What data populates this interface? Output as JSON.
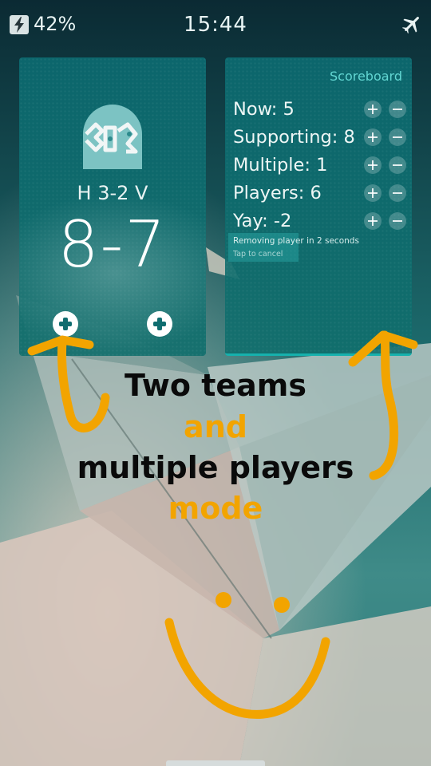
{
  "status": {
    "battery": "42%",
    "time": "15:44",
    "icons": [
      "charging-battery-icon",
      "airplane-mode-icon"
    ]
  },
  "home_cover": {
    "match": "H 3-2 V",
    "score": "8-7",
    "icons": [
      "app-logo-icon",
      "add-home-point-icon",
      "add-visitor-point-icon"
    ]
  },
  "scoreboard_cover": {
    "title": "Scoreboard",
    "rows": [
      {
        "label": "Now: 5"
      },
      {
        "label": "Supporting: 8"
      },
      {
        "label": "Multiple: 1"
      },
      {
        "label": "Players: 6"
      },
      {
        "label": "Yay: -2"
      }
    ],
    "remorse_message": "Removing player in 2 seconds",
    "remorse_hint": "Tap to cancel"
  },
  "caption": {
    "line1": "Two teams",
    "line2": "and",
    "line3": "multiple players",
    "line4": "mode"
  },
  "colors": {
    "accent": "#f2a400",
    "cover": "#0c6a70",
    "highlight": "#62d6d2"
  }
}
